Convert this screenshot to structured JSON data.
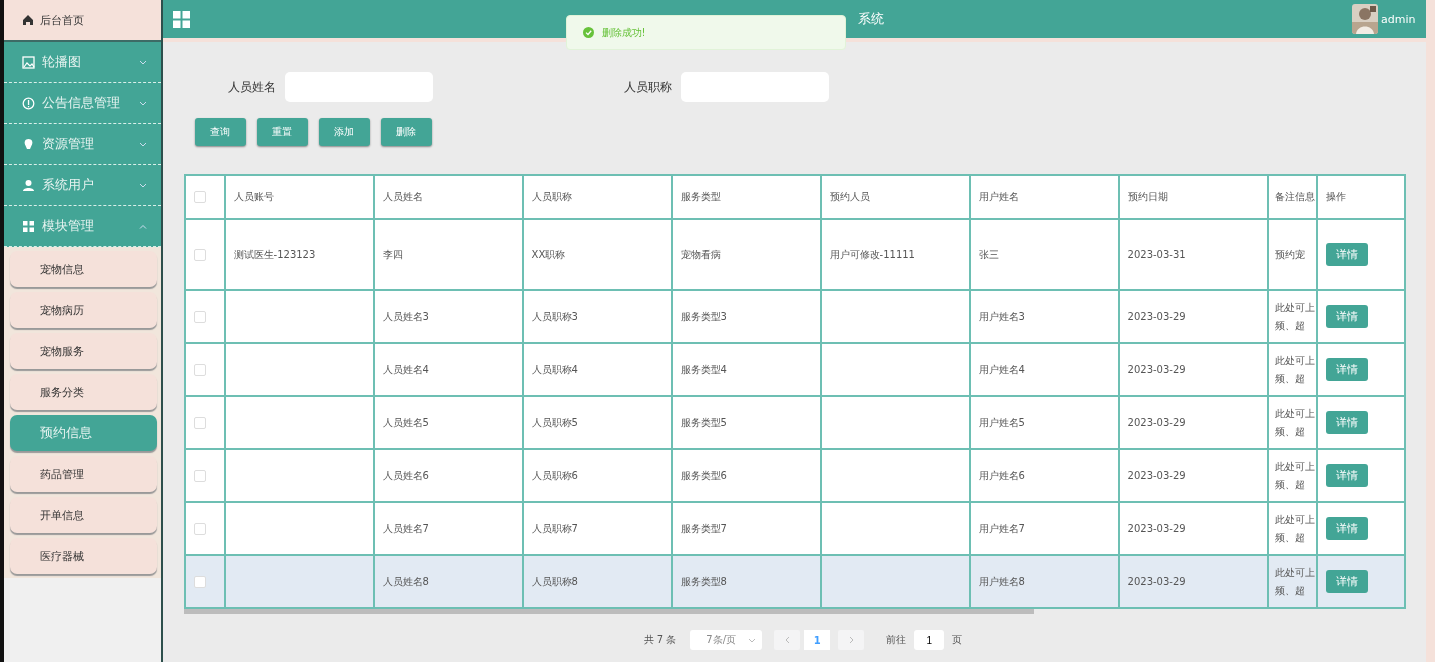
{
  "sidebar": {
    "home": {
      "label": "后台首页"
    },
    "menus": [
      {
        "label": "轮播图",
        "expanded": false
      },
      {
        "label": "公告信息管理",
        "expanded": false
      },
      {
        "label": "资源管理",
        "expanded": false
      },
      {
        "label": "系统用户",
        "expanded": false
      },
      {
        "label": "模块管理",
        "expanded": true,
        "children": [
          {
            "label": "宠物信息",
            "selected": false
          },
          {
            "label": "宠物病历",
            "selected": false
          },
          {
            "label": "宠物服务",
            "selected": false
          },
          {
            "label": "服务分类",
            "selected": false
          },
          {
            "label": "预约信息",
            "selected": true
          },
          {
            "label": "药品管理",
            "selected": false
          },
          {
            "label": "开单信息",
            "selected": false
          },
          {
            "label": "医疗器械",
            "selected": false
          }
        ]
      }
    ]
  },
  "header": {
    "title": "系统",
    "user": "admin"
  },
  "toast": {
    "kind": "success",
    "message": "删除成功!"
  },
  "search": {
    "fields": [
      {
        "label": "人员姓名"
      },
      {
        "label": "人员职称"
      }
    ],
    "buttons": [
      "查询",
      "重置",
      "添加",
      "删除"
    ]
  },
  "table": {
    "all_checked": false,
    "columns": [
      "人员账号",
      "人员姓名",
      "人员职称",
      "服务类型",
      "预约人员",
      "用户姓名",
      "预约日期",
      "备注信息",
      "操作"
    ],
    "rows": [
      {
        "checked": false,
        "hovered": false,
        "cells": [
          "测试医生-123123",
          "李四",
          "XX职称",
          "宠物看病",
          "用户可修改-11111",
          "张三",
          "2023-03-31",
          "预约宠"
        ],
        "action": "详情"
      },
      {
        "checked": false,
        "hovered": false,
        "cells": [
          "",
          "人员姓名3",
          "人员职称3",
          "服务类型3",
          "",
          "用户姓名3",
          "2023-03-29",
          "此处可上频、超"
        ],
        "action": "详情"
      },
      {
        "checked": false,
        "hovered": false,
        "cells": [
          "",
          "人员姓名4",
          "人员职称4",
          "服务类型4",
          "",
          "用户姓名4",
          "2023-03-29",
          "此处可上频、超"
        ],
        "action": "详情"
      },
      {
        "checked": false,
        "hovered": false,
        "cells": [
          "",
          "人员姓名5",
          "人员职称5",
          "服务类型5",
          "",
          "用户姓名5",
          "2023-03-29",
          "此处可上频、超"
        ],
        "action": "详情"
      },
      {
        "checked": false,
        "hovered": false,
        "cells": [
          "",
          "人员姓名6",
          "人员职称6",
          "服务类型6",
          "",
          "用户姓名6",
          "2023-03-29",
          "此处可上频、超"
        ],
        "action": "详情"
      },
      {
        "checked": false,
        "hovered": false,
        "cells": [
          "",
          "人员姓名7",
          "人员职称7",
          "服务类型7",
          "",
          "用户姓名7",
          "2023-03-29",
          "此处可上频、超"
        ],
        "action": "详情"
      },
      {
        "checked": false,
        "hovered": true,
        "cells": [
          "",
          "人员姓名8",
          "人员职称8",
          "服务类型8",
          "",
          "用户姓名8",
          "2023-03-29",
          "此处可上频、超"
        ],
        "action": "详情"
      }
    ]
  },
  "pagination": {
    "total": "共 7 条",
    "page_size": "7条/页",
    "pages": [
      {
        "label": "1",
        "selected": true
      }
    ],
    "goto_label": "前往",
    "goto_value": "1",
    "goto_suffix": "页"
  }
}
